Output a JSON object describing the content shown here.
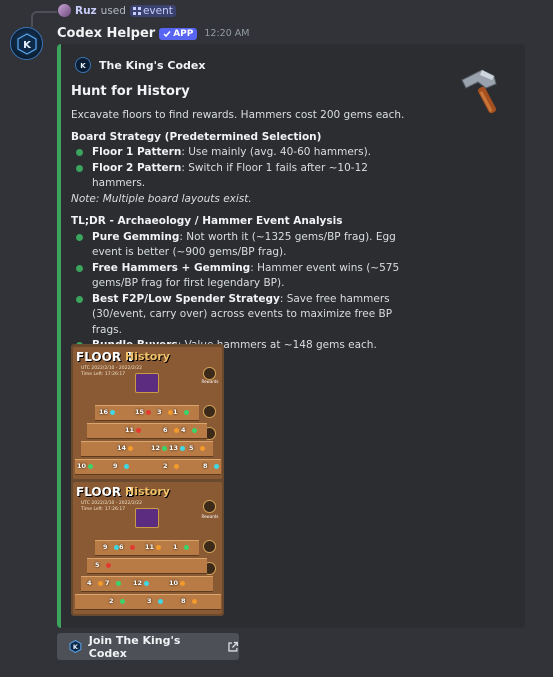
{
  "reply": {
    "user": "Ruz",
    "used_text": "used",
    "command": "event"
  },
  "message": {
    "bot_name": "Codex Helper",
    "app_badge": "APP",
    "timestamp": "12:20 AM"
  },
  "embed": {
    "author": "The King's Codex",
    "title": "Hunt for History",
    "intro": "Excavate floors to find rewards. Hammers cost 200 gems each.",
    "section1_heading": "Board Strategy (Predetermined Selection)",
    "section1_items": [
      {
        "bold": "Floor 1 Pattern",
        "text": ": Use mainly (avg. 40-60 hammers)."
      },
      {
        "bold": "Floor 2 Pattern",
        "text": ": Switch if Floor 1 fails after ~10-12 hammers."
      }
    ],
    "section1_note": "Note: Multiple board layouts exist.",
    "section2_heading": "TL;DR - Archaeology / Hammer Event Analysis",
    "section2_items": [
      {
        "bold": "Pure Gemming",
        "text": ": Not worth it (~1325 gems/BP frag). Egg event is better (~900 gems/BP frag)."
      },
      {
        "bold": "Free Hammers + Gemming",
        "text": ": Hammer event wins (~575 gems/BP frag for first legendary BP)."
      },
      {
        "bold": "Best F2P/Low Spender Strategy",
        "text": ": Save free hammers (30/event, carry over) across events to maximize free BP frags."
      },
      {
        "bold": "Bundle Buyers",
        "text": ": Value hammers at ~148 gems each."
      }
    ],
    "image": {
      "floor1": {
        "title": "FLOOR 1",
        "subtitle": "History",
        "meta1": "UTC 2022/2/10 - 2022/2/22",
        "meta2": "Time Left: 17:26:17",
        "side_label": "Rewards",
        "numbers": [
          "16",
          "15",
          "3",
          "1",
          "11",
          "6",
          "4",
          "14",
          "12",
          "13",
          "5",
          "10",
          "9",
          "2",
          "8",
          "7"
        ]
      },
      "floor2": {
        "title": "FLOOR 2",
        "subtitle": "History",
        "meta1": "UTC 2022/2/10 - 2022/2/22",
        "meta2": "Time Left: 17:26:17",
        "side_label": "Rewards",
        "numbers": [
          "9",
          "6",
          "11",
          "1",
          "5",
          "4",
          "7",
          "12",
          "10",
          "2",
          "3",
          "8"
        ]
      }
    }
  },
  "button": {
    "label": "Join The King's Codex"
  },
  "colors": {
    "accent": "#3ba55d",
    "app_badge": "#5865f2",
    "background": "#313338",
    "embed_bg": "#2b2d31"
  },
  "icons": [
    "codex-logo-icon",
    "hammer-icon",
    "external-link-icon",
    "slash-command-icon",
    "checkmark-icon"
  ]
}
